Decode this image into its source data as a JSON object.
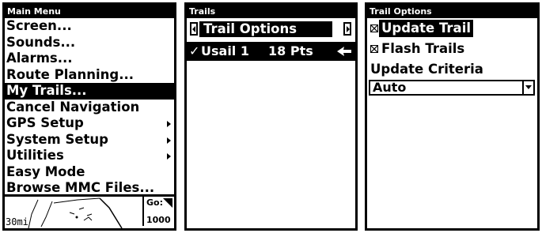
{
  "main_menu": {
    "title": "Main Menu",
    "items": [
      {
        "label": "Screen...",
        "submenu": false,
        "selected": false
      },
      {
        "label": "Sounds...",
        "submenu": false,
        "selected": false
      },
      {
        "label": "Alarms...",
        "submenu": false,
        "selected": false
      },
      {
        "label": "Route Planning...",
        "submenu": false,
        "selected": false
      },
      {
        "label": "My Trails...",
        "submenu": false,
        "selected": true
      },
      {
        "label": "Cancel Navigation",
        "submenu": false,
        "selected": false
      },
      {
        "label": "GPS Setup",
        "submenu": true,
        "selected": false
      },
      {
        "label": "System Setup",
        "submenu": true,
        "selected": false
      },
      {
        "label": "Utilities",
        "submenu": true,
        "selected": false
      },
      {
        "label": "Easy Mode",
        "submenu": false,
        "selected": false
      },
      {
        "label": "Browse MMC Files...",
        "submenu": false,
        "selected": false
      }
    ],
    "map": {
      "scale": "30mi",
      "goto_label": "Go:",
      "goto_value": "1000"
    }
  },
  "trails": {
    "title": "Trails",
    "tab_label": "Trail Options",
    "items": [
      {
        "check": "✓",
        "name": "Usail 1",
        "points": "18 Pts",
        "selected": true
      }
    ]
  },
  "trail_options": {
    "title": "Trail Options",
    "options": [
      {
        "label": "Update Trail",
        "checked": true,
        "selected": true
      },
      {
        "label": "Flash Trails",
        "checked": true,
        "selected": false
      }
    ],
    "criteria_label": "Update Criteria",
    "criteria_value": "Auto"
  }
}
